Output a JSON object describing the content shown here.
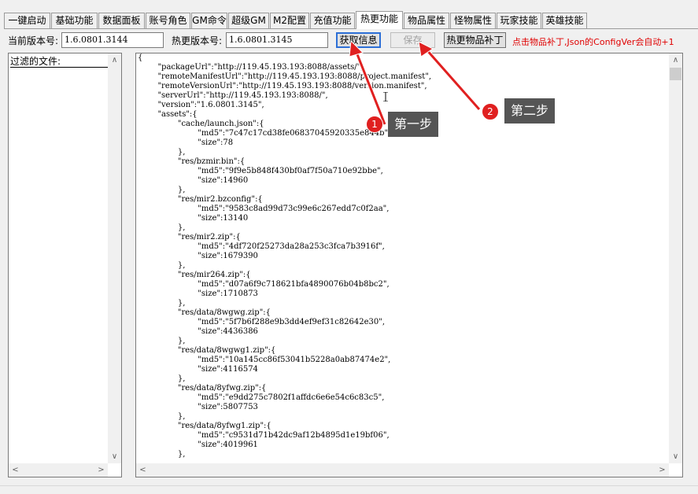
{
  "tabs": [
    {
      "label": "一键启动",
      "active": false
    },
    {
      "label": "基础功能",
      "active": false
    },
    {
      "label": "数据面板",
      "active": false
    },
    {
      "label": "账号角色",
      "active": false
    },
    {
      "label": "GM命令",
      "active": false
    },
    {
      "label": "超级GM",
      "active": false
    },
    {
      "label": "M2配置",
      "active": false
    },
    {
      "label": "充值功能",
      "active": false
    },
    {
      "label": "热更功能",
      "active": true
    },
    {
      "label": "物品属性",
      "active": false
    },
    {
      "label": "怪物属性",
      "active": false
    },
    {
      "label": "玩家技能",
      "active": false
    },
    {
      "label": "英雄技能",
      "active": false
    }
  ],
  "toolbar": {
    "current_version_label": "当前版本号:",
    "current_version_value": "1.6.0801.3144",
    "hotfix_version_label": "热更版本号:",
    "hotfix_version_value": "1.6.0801.3145",
    "get_info_button": "获取信息",
    "save_button": "保存",
    "patch_items_button": "热更物品补丁",
    "hint": "点击物品补丁,Json的ConfigVer会自动+1"
  },
  "file_list": {
    "title": "过滤的文件:"
  },
  "editor": {
    "content": "{\n\t\"packageUrl\":\"http://119.45.193.193:8088/assets/\",\n\t\"remoteManifestUrl\":\"http://119.45.193.193:8088/project.manifest\",\n\t\"remoteVersionUrl\":\"http://119.45.193.193:8088/version.manifest\",\n\t\"serverUrl\":\"http://119.45.193.193:8088/\",\n\t\"version\":\"1.6.0801.3145\",\n\t\"assets\":{\n\t\t\"cache/launch.json\":{\n\t\t\t\"md5\":\"7c47c17cd38fe06837045920335e844b\",\n\t\t\t\"size\":78\n\t\t},\n\t\t\"res/bzmir.bin\":{\n\t\t\t\"md5\":\"9f9e5b848f430bf0af7f50a710e92bbe\",\n\t\t\t\"size\":14960\n\t\t},\n\t\t\"res/mir2.bzconfig\":{\n\t\t\t\"md5\":\"9583c8ad99d73c99e6c267edd7c0f2aa\",\n\t\t\t\"size\":13140\n\t\t},\n\t\t\"res/mir2.zip\":{\n\t\t\t\"md5\":\"4df720f25273da28a253c3fca7b3916f\",\n\t\t\t\"size\":1679390\n\t\t},\n\t\t\"res/mir264.zip\":{\n\t\t\t\"md5\":\"d07a6f9c718621bfa4890076b04b8bc2\",\n\t\t\t\"size\":1710873\n\t\t},\n\t\t\"res/data/8wgwg.zip\":{\n\t\t\t\"md5\":\"5f7b6f288e9b3dd4ef9ef31c82642e30\",\n\t\t\t\"size\":4436386\n\t\t},\n\t\t\"res/data/8wgwg1.zip\":{\n\t\t\t\"md5\":\"10a145cc86f53041b5228a0ab87474e2\",\n\t\t\t\"size\":4116574\n\t\t},\n\t\t\"res/data/8yfwg.zip\":{\n\t\t\t\"md5\":\"e9dd275c7802f1affdc6e6e54c6c83c5\",\n\t\t\t\"size\":5807753\n\t\t},\n\t\t\"res/data/8yfwg1.zip\":{\n\t\t\t\"md5\":\"c9531d71b42dc9af12b4895d1e19bf06\",\n\t\t\t\"size\":4019961\n\t\t},"
  },
  "annotations": {
    "step1_number": "1",
    "step1_label": "第一步",
    "step2_number": "2",
    "step2_label": "第二步"
  },
  "colors": {
    "hint_red": "#e00000",
    "arrow_red": "#e02020",
    "callout_gray": "#555555",
    "focus_blue": "#2d6fd6"
  }
}
